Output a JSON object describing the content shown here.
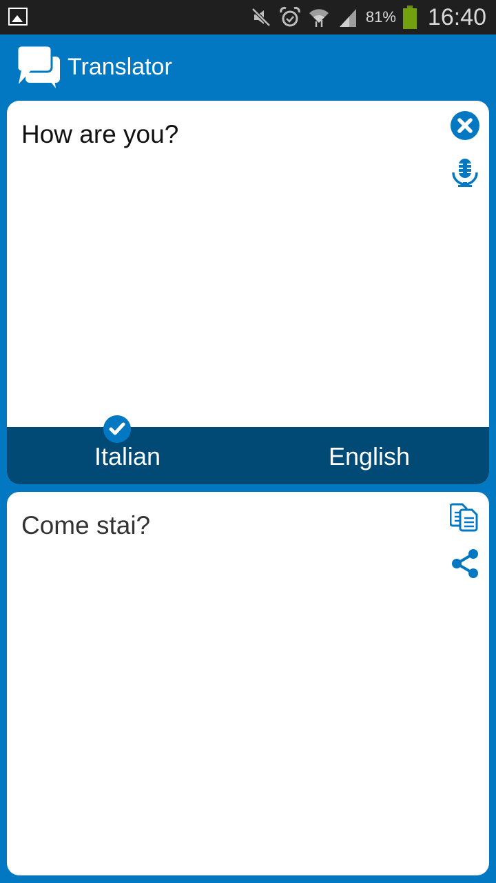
{
  "status_bar": {
    "notification_icon": "gallery-icon",
    "icons": [
      "mute-icon",
      "alarm-icon",
      "wifi-icon",
      "signal-icon"
    ],
    "battery_percent": "81%",
    "battery_level": 0.81,
    "time": "16:40"
  },
  "app": {
    "title": "Translator",
    "logo": "chat-bubbles-icon"
  },
  "input": {
    "text": "How are you?",
    "clear_icon": "close-circle-icon",
    "voice_icon": "microphone-icon"
  },
  "languages": {
    "source": "Italian",
    "target": "English",
    "selected": "Italian"
  },
  "output": {
    "text": "Come stai?",
    "copy_icon": "copy-icon",
    "share_icon": "share-icon"
  },
  "colors": {
    "primary": "#0277c2",
    "language_bar": "#004a75",
    "status_bar": "#1f1f1f",
    "battery": "#73a00f"
  }
}
